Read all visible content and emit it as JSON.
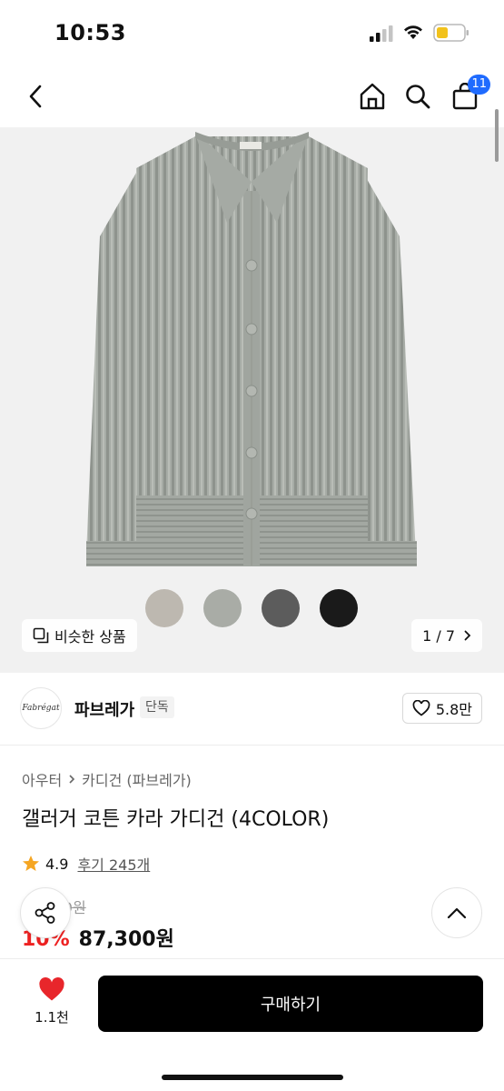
{
  "status": {
    "time": "10:53"
  },
  "nav": {
    "cart_count": "11"
  },
  "hero": {
    "swatch_colors": [
      "#bdb8b0",
      "#a9aca6",
      "#5c5c5c",
      "#1a1a1a"
    ],
    "similar_label": "비슷한 상품",
    "pager": "1 / 7"
  },
  "brand": {
    "logo_text": "Fabrégat",
    "name": "파브레가",
    "tag": "단독",
    "likes": "5.8만"
  },
  "product": {
    "breadcrumb": [
      "아우터",
      "카디건 (파브레가)"
    ],
    "title": "갤러거 코튼 카라 가디건 (4COLOR)",
    "rating": "4.9",
    "reviews": "후기 245개",
    "original_price": "97,000원",
    "discount": "10%",
    "price": "87,300원"
  },
  "bottom": {
    "heart_count": "1.1천",
    "buy_label": "구매하기"
  },
  "colors": {
    "accent_blue": "#1f6bff",
    "discount_red": "#ee2222",
    "star": "#f5a623",
    "heart": "#e8262b"
  }
}
